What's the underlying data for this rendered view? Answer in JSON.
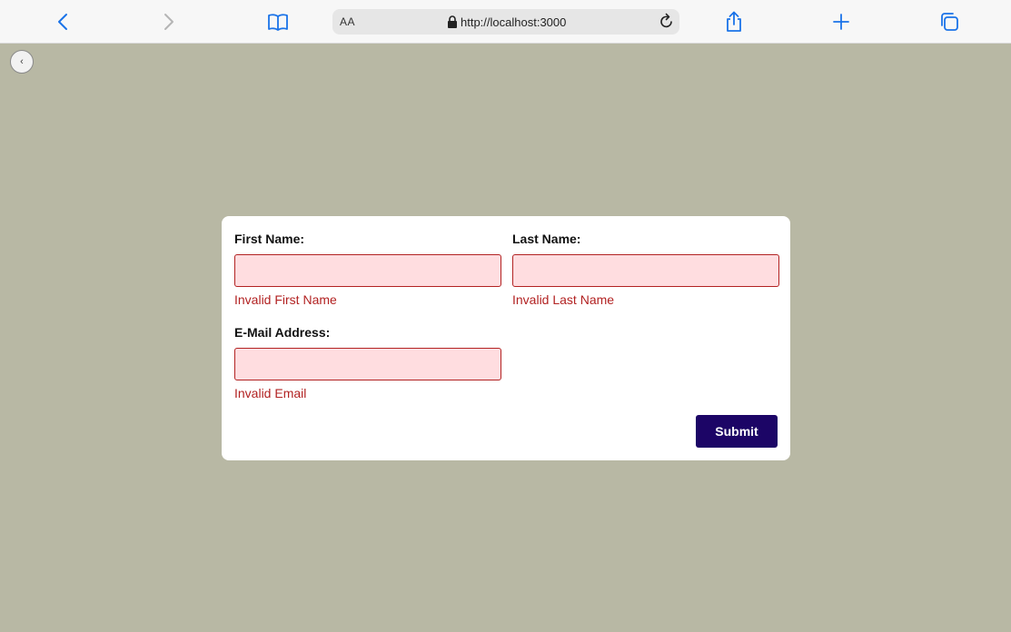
{
  "browser": {
    "url": "http://localhost:3000",
    "reader_label": "AA",
    "icons": [
      "back-icon",
      "forward-icon",
      "book-icon",
      "lock-icon",
      "reload-icon",
      "share-icon",
      "plus-icon",
      "tabs-icon"
    ],
    "accent": "#1a73e8"
  },
  "sidebar_toggle": {
    "glyph": "‹"
  },
  "form": {
    "first_name": {
      "label": "First Name:",
      "value": "",
      "error": "Invalid First Name"
    },
    "last_name": {
      "label": "Last Name:",
      "value": "",
      "error": "Invalid Last Name"
    },
    "email": {
      "label": "E-Mail Address:",
      "value": "",
      "error": "Invalid Email"
    },
    "submit_label": "Submit",
    "colors": {
      "error": "#b22222",
      "error_bg": "#ffdde0",
      "button": "#1c0566"
    }
  },
  "page_background": "#b8b8a4"
}
